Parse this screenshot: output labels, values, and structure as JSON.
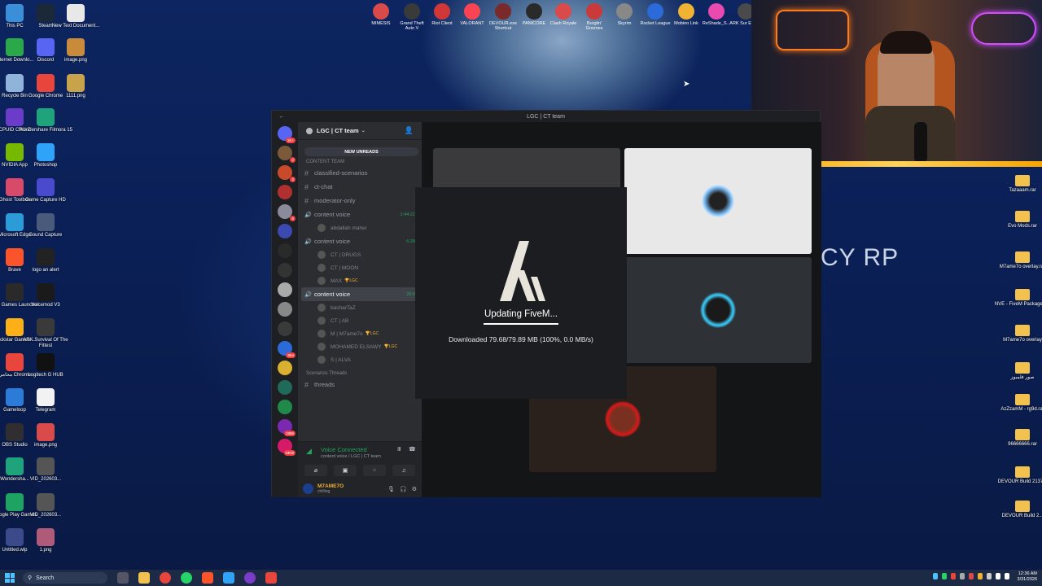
{
  "desktop": {
    "left_icons": [
      {
        "label": "This PC",
        "color": "#3b8fd9"
      },
      {
        "label": "Steam",
        "color": "#1b2838"
      },
      {
        "label": "New Text Document...",
        "color": "#e8e8e8"
      },
      {
        "label": "Internet Downlo...",
        "color": "#2aa84a"
      },
      {
        "label": "Discord",
        "color": "#5865f2"
      },
      {
        "label": "image.png",
        "color": "#c98b3b"
      },
      {
        "label": "Recycle Bin",
        "color": "#8fb3d9"
      },
      {
        "label": "Google Chrome",
        "color": "#e8453c"
      },
      {
        "label": "1111.png",
        "color": "#c9a34b"
      },
      {
        "label": "CPUID CPU-Z",
        "color": "#6a3cc9"
      },
      {
        "label": "Wondershare Filmora 15",
        "color": "#1fa37a"
      },
      {
        "label": "NVIDIA App",
        "color": "#76b900"
      },
      {
        "label": "Photoshop",
        "color": "#2fa3f7"
      },
      {
        "label": "Ghost Toolbox",
        "color": "#d94a6a"
      },
      {
        "label": "Game Capture HD",
        "color": "#4a4acf"
      },
      {
        "label": "Microsoft Edge",
        "color": "#2b9cd8"
      },
      {
        "label": "Sound Capture",
        "color": "#4a5a7a"
      },
      {
        "label": "Brave",
        "color": "#fb542b"
      },
      {
        "label": "logo an alert",
        "color": "#222"
      },
      {
        "label": "Epic Games Launcher",
        "color": "#2a2a2a"
      },
      {
        "label": "Voicemod V3",
        "color": "#1a1a1a"
      },
      {
        "label": "Rockstar Games ...",
        "color": "#fcaf17"
      },
      {
        "label": "ARK Survival Of The Fittest",
        "color": "#3a3a3a"
      },
      {
        "label": "محامي Chrome",
        "color": "#e8453c"
      },
      {
        "label": "Logitech G HUB",
        "color": "#111"
      },
      {
        "label": "Gameloop",
        "color": "#2b7bd9"
      },
      {
        "label": "Telegram",
        "color": "#f2f2f2"
      },
      {
        "label": "OBS Studio",
        "color": "#302e31"
      },
      {
        "label": "image.png",
        "color": "#d94a4a"
      },
      {
        "label": "Wondersha...",
        "color": "#1fa37a"
      },
      {
        "label": "VID_202603...",
        "color": "#555"
      },
      {
        "label": "Google Play Games",
        "color": "#1ea362"
      },
      {
        "label": "VID_202603...",
        "color": "#555"
      },
      {
        "label": "Untitled.wlp",
        "color": "#3a4a8a"
      },
      {
        "label": "1.png",
        "color": "#b05a7a"
      }
    ],
    "top_icons": [
      {
        "label": "MIMESIS",
        "color": "#d94a4a"
      },
      {
        "label": "Grand Theft Auto V",
        "color": "#3a3a3a"
      },
      {
        "label": "Riot Client",
        "color": "#d13639"
      },
      {
        "label": "VALORANT",
        "color": "#fa4454"
      },
      {
        "label": "DEVOUR.exe Shortcut",
        "color": "#7a2a2a"
      },
      {
        "label": "PANICORE",
        "color": "#2a2a2a"
      },
      {
        "label": "Clash Royale",
        "color": "#d94a4a"
      },
      {
        "label": "Burglin' Gnomes",
        "color": "#c93a3a"
      },
      {
        "label": "Skyrim",
        "color": "#888"
      },
      {
        "label": "Rocket League",
        "color": "#2b6bd9"
      },
      {
        "label": "Mobino Link",
        "color": "#f0b232"
      },
      {
        "label": "ReShade_S...",
        "color": "#e84ab0"
      },
      {
        "label": "ARK Sur Evolve",
        "color": "#4a4a4a"
      }
    ],
    "right_icons": [
      {
        "label": "Tazaaam.rar"
      },
      {
        "label": "Evo Mods.rar"
      },
      {
        "label": "M7ame7o overlay.rar"
      },
      {
        "label": "NVE - FiveM Package.zip"
      },
      {
        "label": "M7ame7o overlay"
      },
      {
        "label": "صور فلمبوز"
      },
      {
        "label": "AzZzamM - rg9d.rar"
      },
      {
        "label": "96666666.rar"
      },
      {
        "label": "DEVOUR Build 2137..."
      },
      {
        "label": "DEVOUR Build 2..."
      }
    ],
    "wallpaper_text": "CY RP"
  },
  "discord": {
    "window_title": "LGC | CT team",
    "server_name": "LGC | CT team",
    "new_unreads": "NEW UNREADS",
    "category_partial": "CONTENT TEAM",
    "channels": [
      {
        "type": "text",
        "name": "classified-scenarios"
      },
      {
        "type": "text",
        "name": "ct-chat"
      },
      {
        "type": "text",
        "name": "moderator-only"
      }
    ],
    "voice1": {
      "name": "content voice",
      "time": "2:44:21"
    },
    "voice1_users": [
      {
        "name": "abdallah maher"
      }
    ],
    "voice2": {
      "name": "content voice",
      "time": "6:28"
    },
    "voice2_users": [
      {
        "name": "CT | DRUGS",
        "tag": ""
      },
      {
        "name": "CT | MOON",
        "tag": ""
      },
      {
        "name": "MAX",
        "tag": "🏆LGC"
      }
    ],
    "voice3": {
      "name": "content voice",
      "time": "20:0"
    },
    "voice3_users": [
      {
        "name": "basharTaZ",
        "tag": ""
      },
      {
        "name": "CT | AB",
        "tag": ""
      },
      {
        "name": "M | M7ame7o",
        "tag": "🏆LGC"
      },
      {
        "name": "MOHAMED ELSAWY",
        "tag": "🏆LGC"
      },
      {
        "name": "S | ALVA",
        "tag": ""
      }
    ],
    "threads_category": "Scenarios Threads",
    "threads_channel": "threads",
    "voice_connected": "Voice Connected",
    "voice_sub": "content voice / LGC | CT team",
    "user_name": "M7AME7O",
    "user_status": "chilling",
    "server_badges": [
      "1K+",
      "2",
      "2",
      "",
      "6",
      "",
      "",
      "",
      "",
      "",
      "",
      "854",
      "",
      "",
      "",
      "1989",
      "NEW"
    ]
  },
  "fivem": {
    "status": "Updating FiveM...",
    "downloaded": "Downloaded 79.68/79.89 MB (100%, 0.0 MB/s)"
  },
  "taskbar": {
    "search_placeholder": "Search",
    "time": "12:36 AM",
    "date": "3/31/2026"
  }
}
